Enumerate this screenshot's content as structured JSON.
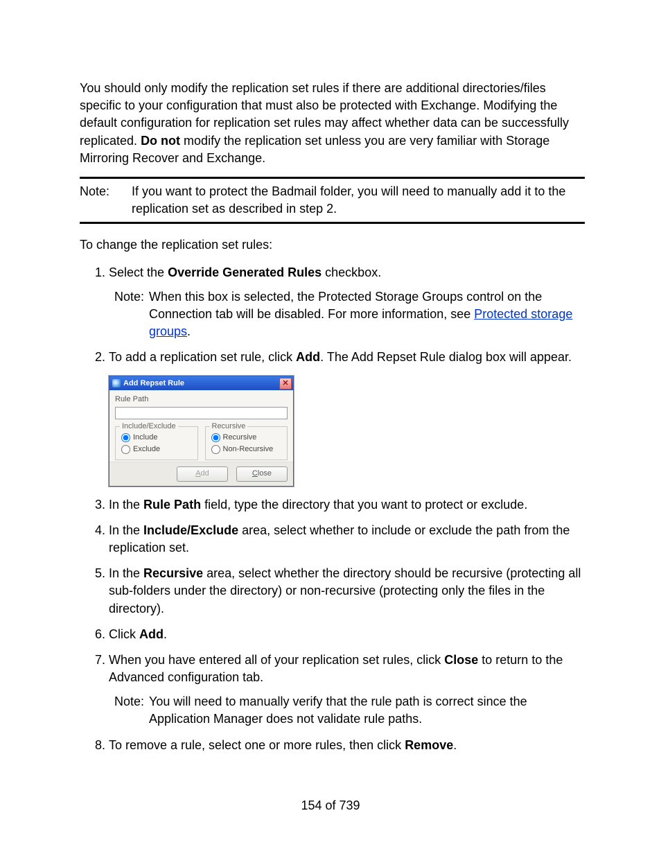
{
  "intro": {
    "p1_a": "You should only modify the replication set rules if there are additional directories/files specific to your configuration that must also be protected with Exchange. Modifying the default configuration for replication set rules may affect whether data can be successfully replicated. ",
    "p1_bold": "Do not",
    "p1_b": " modify the replication set unless you are very familiar with Storage Mirroring Recover and Exchange."
  },
  "note1": {
    "label": "Note:",
    "text": "If you want to protect the Badmail folder, you will need to manually add it to the replication set as described in step 2."
  },
  "lead": "To change the replication set rules:",
  "steps": {
    "s1_a": "Select the ",
    "s1_bold": "Override Generated Rules",
    "s1_b": " checkbox.",
    "s1_note_label": "Note:",
    "s1_note_a": "When this box is selected, the Protected Storage Groups control on the Connection tab will be disabled. For more information, see ",
    "s1_note_link": "Protected storage groups",
    "s1_note_b": ".",
    "s2_a": "To add a replication set rule, click ",
    "s2_bold": "Add",
    "s2_b": ". The Add Repset Rule dialog box will appear.",
    "s3_a": "In the ",
    "s3_bold": "Rule Path",
    "s3_b": " field, type the directory that you want to protect or exclude.",
    "s4_a": "In the ",
    "s4_bold": "Include/Exclude",
    "s4_b": " area, select whether to include or exclude the path from the replication set.",
    "s5_a": "In the ",
    "s5_bold": "Recursive",
    "s5_b": " area, select whether the directory should be recursive (protecting all sub-folders under the directory) or non-recursive (protecting only the files in the directory).",
    "s6_a": "Click ",
    "s6_bold": "Add",
    "s6_b": ".",
    "s7_a": "When you have entered all of your replication set rules, click ",
    "s7_bold": "Close",
    "s7_b": " to return to the Advanced configuration tab.",
    "s7_note_label": "Note:",
    "s7_note_text": "You will need to manually verify that the rule path is correct since the Application Manager does not validate rule paths.",
    "s8_a": "To remove a rule, select one or more rules, then click ",
    "s8_bold": "Remove",
    "s8_b": "."
  },
  "dialog": {
    "title": "Add Repset Rule",
    "rule_path_label": "Rule Path",
    "rule_path_value": "",
    "group1_legend": "Include/Exclude",
    "opt_include": "Include",
    "opt_exclude": "Exclude",
    "group2_legend": "Recursive",
    "opt_recursive": "Recursive",
    "opt_nonrecursive": "Non-Recursive",
    "btn_add_u": "A",
    "btn_add_rest": "dd",
    "btn_close_u": "C",
    "btn_close_rest": "lose"
  },
  "footer": "154 of 739"
}
